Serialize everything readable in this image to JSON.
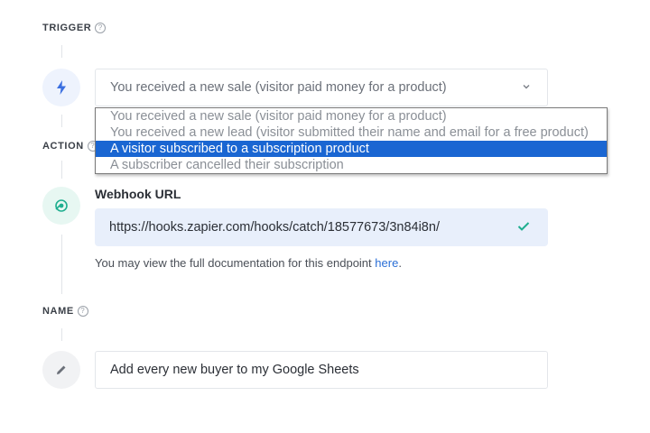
{
  "trigger": {
    "label": "TRIGGER",
    "help": "?",
    "selected_value": "You received a new sale (visitor paid money for a product)",
    "options": [
      "You received a new sale (visitor paid money for a product)",
      "You received a new lead (visitor submitted their name and email for a free product)",
      "A visitor subscribed to a subscription product",
      "A subscriber cancelled their subscription"
    ],
    "highlighted_index": 2
  },
  "action": {
    "label": "ACTION",
    "help": "?",
    "field_label": "Webhook URL",
    "url": "https://hooks.zapier.com/hooks/catch/18577673/3n84i8n/",
    "doc_note": "You may view the full documentation for this endpoint",
    "doc_link": "here",
    "doc_period": "."
  },
  "name": {
    "label": "NAME",
    "help": "?",
    "value": "Add every new buyer to my Google Sheets"
  },
  "colors": {
    "accent": "#1a66d2",
    "trigger_icon": "#3b6fe0",
    "webhook_icon": "#1fae8f",
    "check": "#1fae8f"
  },
  "icons": {
    "trigger": "lightning-icon",
    "action": "webhook-icon",
    "name": "pencil-icon",
    "select": "chevron-down-icon",
    "valid": "check-icon"
  }
}
